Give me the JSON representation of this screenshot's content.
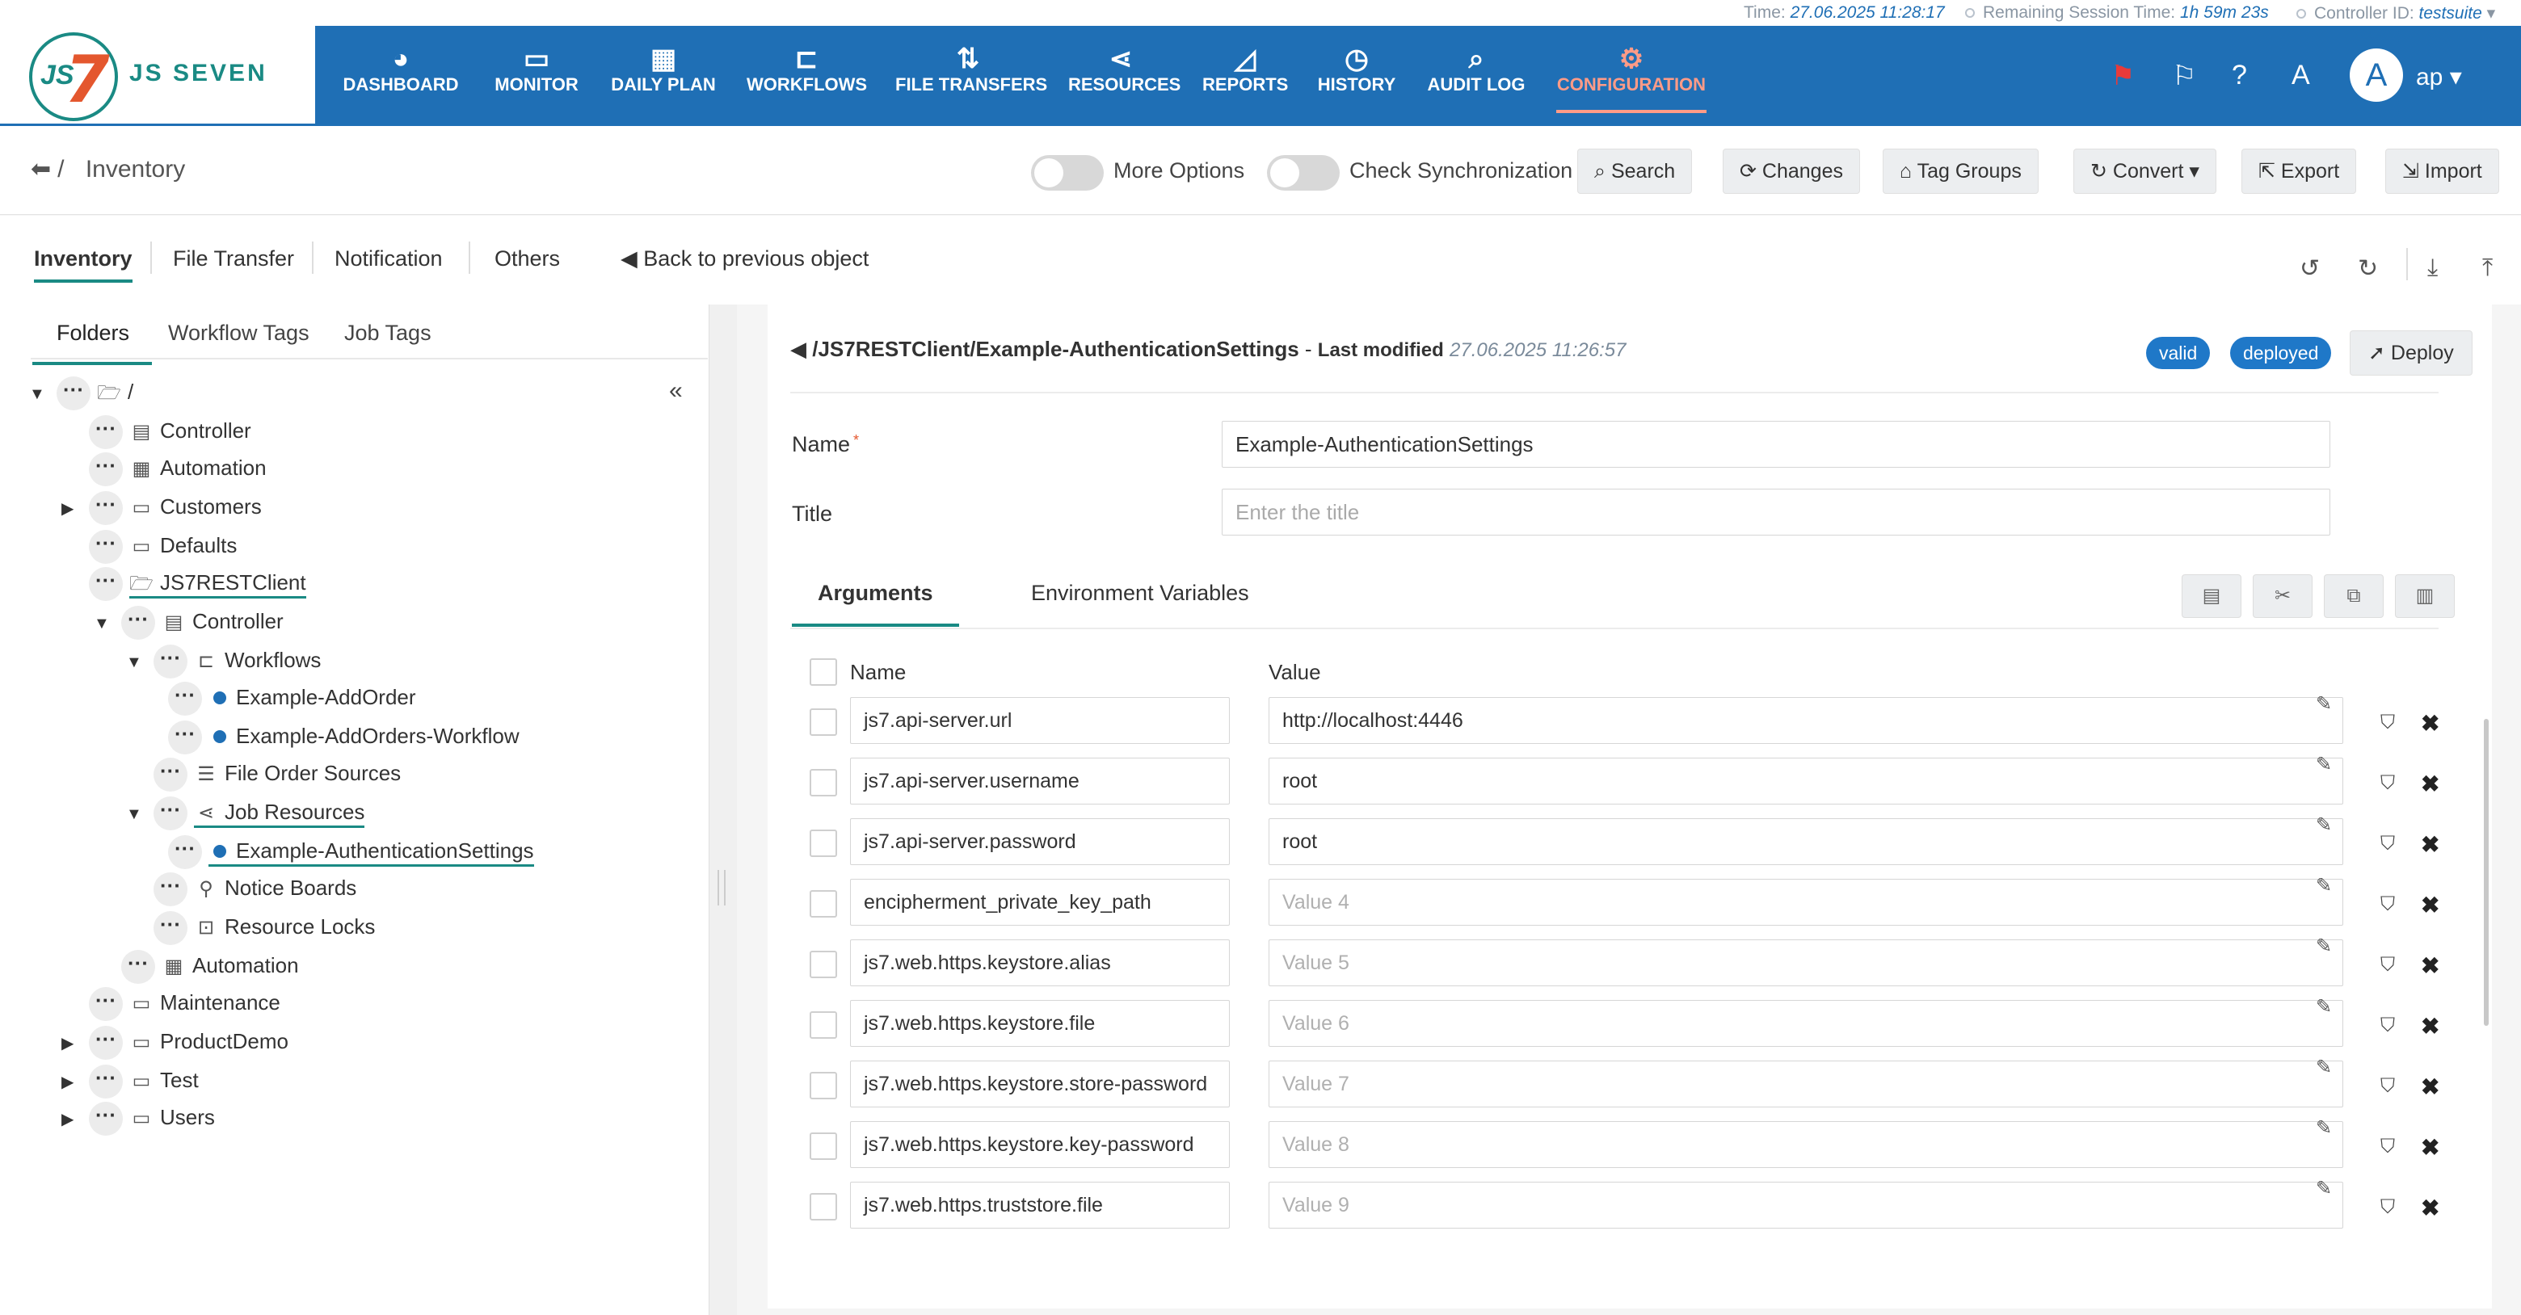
{
  "topinfo": {
    "time_label": "Time:",
    "time_value": "27.06.2025 11:28:17",
    "session_label": "Remaining Session Time:",
    "session_value": "1h 59m 23s",
    "controller_label": "Controller ID:",
    "controller_value": "testsuite"
  },
  "logo": {
    "mark_text": "JS",
    "mark_seven": "7",
    "brand": "JS SEVEN"
  },
  "nav": [
    {
      "label": "DASHBOARD",
      "icon": "gauge-icon"
    },
    {
      "label": "MONITOR",
      "icon": "monitor-icon"
    },
    {
      "label": "DAILY PLAN",
      "icon": "calendar-clock-icon"
    },
    {
      "label": "WORKFLOWS",
      "icon": "workflow-icon"
    },
    {
      "label": "FILE TRANSFERS",
      "icon": "transfer-arrows-icon"
    },
    {
      "label": "RESOURCES",
      "icon": "share-nodes-icon"
    },
    {
      "label": "REPORTS",
      "icon": "chart-icon"
    },
    {
      "label": "HISTORY",
      "icon": "alarm-clock-icon"
    },
    {
      "label": "AUDIT LOG",
      "icon": "search-doc-icon"
    },
    {
      "label": "CONFIGURATION",
      "icon": "gears-icon"
    }
  ],
  "user": {
    "avatar": "A",
    "name": "ap"
  },
  "subheader": {
    "breadcrumb": "Inventory",
    "more_options": "More Options",
    "check_sync": "Check Synchronization",
    "buttons": {
      "search": "Search",
      "changes": "Changes",
      "tag_groups": "Tag Groups",
      "convert": "Convert",
      "export": "Export",
      "import": "Import"
    }
  },
  "main_tabs": [
    "Inventory",
    "File Transfer",
    "Notification",
    "Others"
  ],
  "back_link": "Back to previous object",
  "side_tabs": [
    "Folders",
    "Workflow Tags",
    "Job Tags"
  ],
  "tree": [
    {
      "label": "/",
      "icon": "folder-open-icon"
    },
    {
      "label": "Controller",
      "icon": "controller-icon"
    },
    {
      "label": "Automation",
      "icon": "calendar-clock-icon"
    },
    {
      "label": "Customers",
      "icon": "folder-icon"
    },
    {
      "label": "Defaults",
      "icon": "folder-icon"
    },
    {
      "label": "JS7RESTClient",
      "icon": "folder-open-icon"
    },
    {
      "label": "Controller",
      "icon": "controller-icon"
    },
    {
      "label": "Workflows",
      "icon": "workflow-icon"
    },
    {
      "label": "Example-AddOrder",
      "icon": "dot-icon"
    },
    {
      "label": "Example-AddOrders-Workflow",
      "icon": "dot-icon"
    },
    {
      "label": "File Order Sources",
      "icon": "list-icon"
    },
    {
      "label": "Job Resources",
      "icon": "share-nodes-icon"
    },
    {
      "label": "Example-AuthenticationSettings",
      "icon": "dot-icon"
    },
    {
      "label": "Notice Boards",
      "icon": "pin-icon"
    },
    {
      "label": "Resource Locks",
      "icon": "lock-icon"
    },
    {
      "label": "Automation",
      "icon": "calendar-clock-icon"
    },
    {
      "label": "Maintenance",
      "icon": "folder-icon"
    },
    {
      "label": "ProductDemo",
      "icon": "folder-icon"
    },
    {
      "label": "Test",
      "icon": "folder-icon"
    },
    {
      "label": "Users",
      "icon": "folder-icon"
    }
  ],
  "object": {
    "path": "/JS7RESTClient/Example-AuthenticationSettings",
    "dash": " - ",
    "modified_label": "Last modified",
    "modified_date": "27.06.2025 11:26:57",
    "status_valid": "valid",
    "status_deployed": "deployed",
    "deploy_label": "Deploy",
    "name_label": "Name",
    "name_required": "*",
    "name_value": "Example-AuthenticationSettings",
    "title_label": "Title",
    "title_placeholder": "Enter the title",
    "tabs": [
      "Arguments",
      "Environment Variables"
    ],
    "col_name": "Name",
    "col_value": "Value"
  },
  "arguments": [
    {
      "name": "js7.api-server.url",
      "value": "http://localhost:4446",
      "placeholder": ""
    },
    {
      "name": "js7.api-server.username",
      "value": "root",
      "placeholder": ""
    },
    {
      "name": "js7.api-server.password",
      "value": "root",
      "placeholder": ""
    },
    {
      "name": "encipherment_private_key_path",
      "value": "",
      "placeholder": "Value 4"
    },
    {
      "name": "js7.web.https.keystore.alias",
      "value": "",
      "placeholder": "Value 5"
    },
    {
      "name": "js7.web.https.keystore.file",
      "value": "",
      "placeholder": "Value 6"
    },
    {
      "name": "js7.web.https.keystore.store-password",
      "value": "",
      "placeholder": "Value 7"
    },
    {
      "name": "js7.web.https.keystore.key-password",
      "value": "",
      "placeholder": "Value 8"
    },
    {
      "name": "js7.web.https.truststore.file",
      "value": "",
      "placeholder": "Value 9"
    }
  ],
  "colors": {
    "brand_blue": "#1f6fb5",
    "teal": "#1a8a84",
    "active_nav": "#ff9b87",
    "badge": "#1f78c8"
  }
}
